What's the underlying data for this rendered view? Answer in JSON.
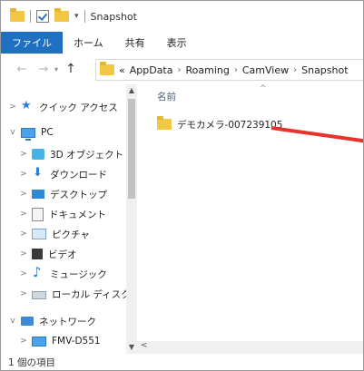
{
  "window": {
    "title": "Snapshot"
  },
  "ribbon": {
    "tabs": [
      "ファイル",
      "ホーム",
      "共有",
      "表示"
    ]
  },
  "address": {
    "crumbs": [
      "AppData",
      "Roaming",
      "CamView",
      "Snapshot"
    ],
    "overflow": "«"
  },
  "nav_pane": {
    "items": [
      {
        "label": "クイック アクセス",
        "icon": "star-icon",
        "level": 0,
        "expand": ">",
        "selected": true
      },
      {
        "label": "PC",
        "icon": "pc-icon",
        "level": 0,
        "expand": "v"
      },
      {
        "label": "3D オブジェクト",
        "icon": "3d-objects-icon",
        "level": 1,
        "expand": ">"
      },
      {
        "label": "ダウンロード",
        "icon": "download-icon",
        "level": 1,
        "expand": ">"
      },
      {
        "label": "デスクトップ",
        "icon": "desktop-icon",
        "level": 1,
        "expand": ">"
      },
      {
        "label": "ドキュメント",
        "icon": "document-icon",
        "level": 1,
        "expand": ">"
      },
      {
        "label": "ピクチャ",
        "icon": "pictures-icon",
        "level": 1,
        "expand": ">"
      },
      {
        "label": "ビデオ",
        "icon": "video-icon",
        "level": 1,
        "expand": ">"
      },
      {
        "label": "ミュージック",
        "icon": "music-icon",
        "level": 1,
        "expand": ">"
      },
      {
        "label": "ローカル ディスク (C",
        "icon": "drive-icon",
        "level": 1,
        "expand": ">"
      },
      {
        "label": "ネットワーク",
        "icon": "network-icon",
        "level": 0,
        "expand": "v"
      },
      {
        "label": "FMV-D551",
        "icon": "computer-icon",
        "level": 1,
        "expand": ">"
      }
    ]
  },
  "content": {
    "column_header": "名前",
    "files": [
      {
        "name": "デモカメラ-007239105",
        "icon": "folder-icon"
      }
    ]
  },
  "status": {
    "text": "1 個の項目"
  },
  "annotation": {
    "color": "#e8322b"
  }
}
